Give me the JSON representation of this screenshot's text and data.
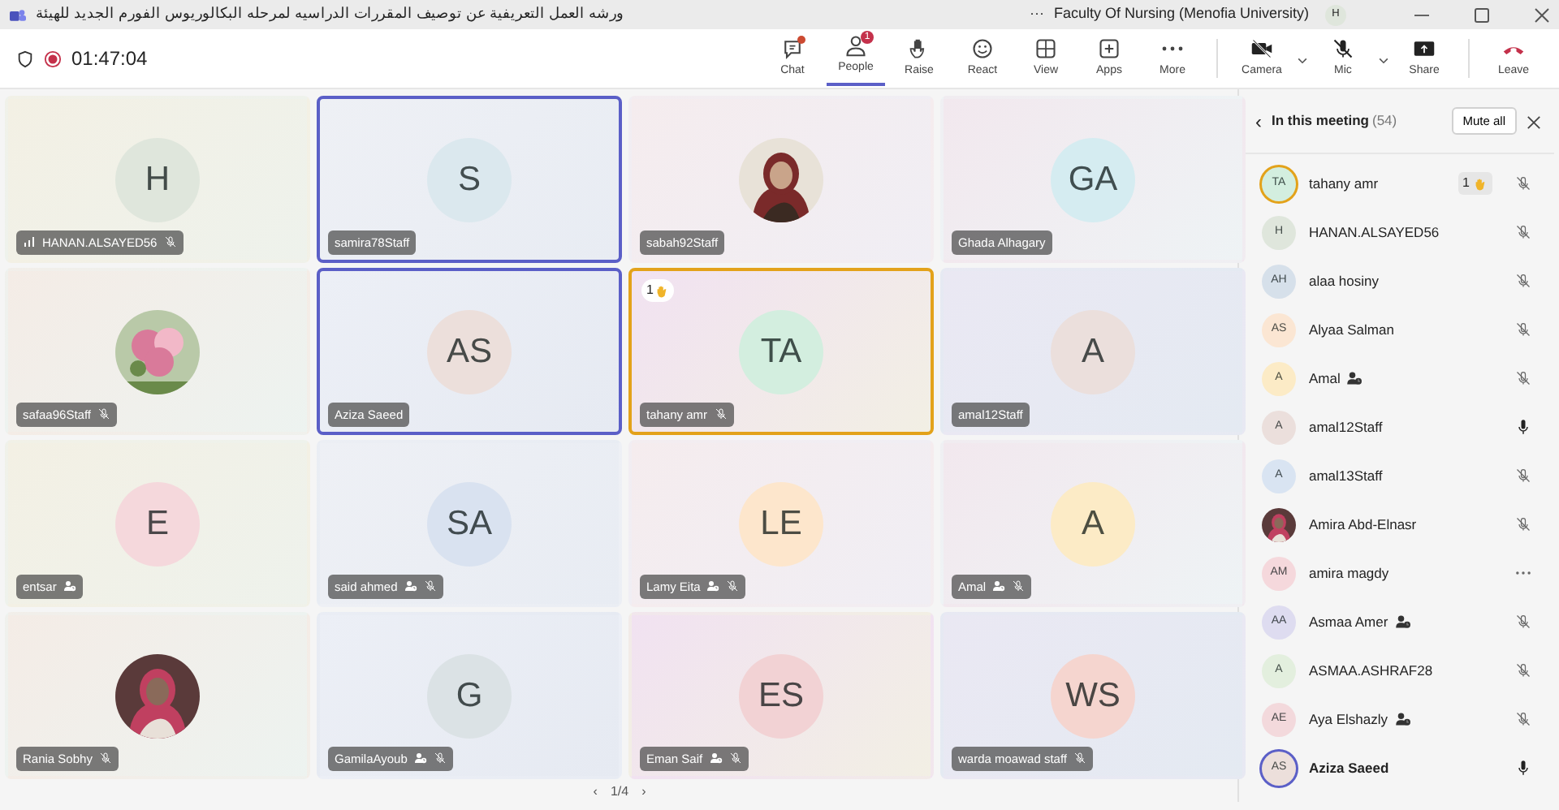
{
  "title_bar": {
    "meeting_title": "ورشه العمل التعريفية عن توصيف المقررات الدراسيه لمرحله البكالوريوس الفورم الجديد للهيئة",
    "more": "···",
    "organization": "Faculty Of Nursing (Menofia University)",
    "user_initials": "H"
  },
  "meeting_bar": {
    "elapsed": "01:47:04",
    "recording": true,
    "controls": [
      {
        "label": "Chat",
        "kind": "chat",
        "selected": false,
        "dot": true
      },
      {
        "label": "People",
        "kind": "people",
        "selected": true,
        "badge": "1"
      },
      {
        "label": "Raise",
        "kind": "raise",
        "selected": false
      },
      {
        "label": "React",
        "kind": "react",
        "selected": false
      },
      {
        "label": "View",
        "kind": "view",
        "selected": false
      },
      {
        "label": "Apps",
        "kind": "apps",
        "selected": false
      },
      {
        "label": "More",
        "kind": "more",
        "selected": false
      },
      {
        "label": "Camera",
        "kind": "camera",
        "selected": false,
        "caret": true
      },
      {
        "label": "Mic",
        "kind": "mic",
        "selected": false,
        "caret": true
      },
      {
        "label": "Share",
        "kind": "share",
        "selected": false
      },
      {
        "label": "Leave",
        "kind": "leave",
        "selected": false
      }
    ]
  },
  "tiles": [
    {
      "name": "HANAN.ALSAYED56",
      "initials": "H",
      "color": "#dfe6dc",
      "signal": true,
      "contact": false,
      "muted": true,
      "highlighted": false,
      "hand_raised": false
    },
    {
      "name": "samira78Staff",
      "initials": "S",
      "color": "#dbe8ee",
      "signal": false,
      "contact": false,
      "muted": false,
      "highlighted": true,
      "hand_raised": false
    },
    {
      "name": "sabah92Staff",
      "kind": "picture",
      "signal": false,
      "contact": false,
      "muted": false,
      "highlighted": false,
      "hand_raised": false
    },
    {
      "name": "Ghada Alhagary",
      "initials": "GA",
      "color": "#d5ecf1",
      "signal": false,
      "contact": false,
      "muted": false,
      "highlighted": false,
      "hand_raised": false
    },
    {
      "name": "safaa96Staff",
      "kind": "picture",
      "signal": false,
      "contact": false,
      "muted": true,
      "highlighted": false,
      "hand_raised": false
    },
    {
      "name": "Aziza Saeed",
      "initials": "AS",
      "color": "#ecdfdb",
      "signal": false,
      "contact": false,
      "muted": false,
      "highlighted": true,
      "hand_raised": false
    },
    {
      "name": "tahany amr",
      "initials": "TA",
      "color": "#d3eedf",
      "signal": false,
      "contact": false,
      "muted": true,
      "highlighted": false,
      "hand_raised": true,
      "hand_count": "1"
    },
    {
      "name": "amal12Staff",
      "initials": "A",
      "color": "#ebdfdc",
      "signal": false,
      "contact": false,
      "muted": false,
      "highlighted": false,
      "hand_raised": false
    },
    {
      "name": "entsar",
      "initials": "E",
      "color": "#f5d8dc",
      "signal": false,
      "contact": true,
      "muted": false,
      "highlighted": false,
      "hand_raised": false
    },
    {
      "name": "said ahmed",
      "initials": "SA",
      "color": "#d9e2f0",
      "signal": false,
      "contact": true,
      "muted": true,
      "highlighted": false,
      "hand_raised": false
    },
    {
      "name": "Lamy Eita",
      "initials": "LE",
      "color": "#fde6cc",
      "signal": false,
      "contact": true,
      "muted": true,
      "highlighted": false,
      "hand_raised": false
    },
    {
      "name": "Amal",
      "initials": "A",
      "color": "#fcebc6",
      "signal": false,
      "contact": true,
      "muted": true,
      "highlighted": false,
      "hand_raised": false
    },
    {
      "name": "Rania Sobhy",
      "kind": "picture",
      "signal": false,
      "contact": false,
      "muted": true,
      "highlighted": false,
      "hand_raised": false
    },
    {
      "name": "GamilaAyoub",
      "initials": "G",
      "color": "#dbe2e5",
      "signal": false,
      "contact": true,
      "muted": true,
      "highlighted": false,
      "hand_raised": false
    },
    {
      "name": "Eman Saif",
      "initials": "ES",
      "color": "#f2d2d4",
      "signal": false,
      "contact": true,
      "muted": true,
      "highlighted": false,
      "hand_raised": false
    },
    {
      "name": "warda moawad staff",
      "initials": "WS",
      "color": "#f5d5cf",
      "signal": false,
      "contact": false,
      "muted": true,
      "highlighted": false,
      "hand_raised": false
    }
  ],
  "pager": {
    "prev": "‹",
    "page": "1/4",
    "next": "›"
  },
  "people_panel": {
    "back": "‹",
    "title": "In this meeting",
    "count": "(54)",
    "mute_all": "Mute all",
    "participants": [
      {
        "name": "tahany amr",
        "initials": "TA",
        "color": "#d3eedf",
        "kind": "mic-off",
        "photo": false,
        "hand_count": "1",
        "contact": false,
        "self": false
      },
      {
        "name": "HANAN.ALSAYED56",
        "initials": "H",
        "color": "#dfe6dc",
        "kind": "mic-off",
        "photo": false,
        "contact": false,
        "self": false
      },
      {
        "name": "alaa hosiny",
        "initials": "AH",
        "color": "#d6e0ea",
        "kind": "mic-off",
        "photo": false,
        "contact": false,
        "self": false
      },
      {
        "name": "Alyaa Salman",
        "initials": "AS",
        "color": "#fbe6d3",
        "kind": "mic-off",
        "photo": false,
        "contact": false,
        "self": false
      },
      {
        "name": "Amal",
        "initials": "A",
        "color": "#fcebc6",
        "kind": "mic-off",
        "photo": false,
        "contact": true,
        "self": false
      },
      {
        "name": "amal12Staff",
        "initials": "A",
        "color": "#ebdfdc",
        "kind": "mic-on",
        "photo": false,
        "contact": false,
        "self": false
      },
      {
        "name": "amal13Staff",
        "initials": "A",
        "color": "#d9e4f2",
        "kind": "mic-off",
        "photo": false,
        "contact": false,
        "self": false
      },
      {
        "name": "Amira Abd-Elnasr",
        "kind": "mic-off",
        "photo": true,
        "contact": false,
        "self": false
      },
      {
        "name": "amira magdy",
        "initials": "AM",
        "color": "#f5d8dc",
        "kind": "more",
        "photo": false,
        "contact": false,
        "self": false
      },
      {
        "name": "Asmaa Amer",
        "initials": "AA",
        "color": "#dedcf0",
        "kind": "mic-off",
        "photo": false,
        "contact": true,
        "self": false
      },
      {
        "name": "ASMAA.ASHRAF28",
        "initials": "A",
        "color": "#e3efde",
        "kind": "mic-off",
        "photo": false,
        "contact": false,
        "self": false
      },
      {
        "name": "Aya Elshazly",
        "initials": "AE",
        "color": "#f3d9dc",
        "kind": "mic-off",
        "photo": false,
        "contact": true,
        "self": false
      },
      {
        "name": "Aziza Saeed",
        "initials": "AS",
        "color": "#ecdfdb",
        "kind": "mic-on",
        "photo": false,
        "contact": false,
        "self": true
      }
    ]
  }
}
